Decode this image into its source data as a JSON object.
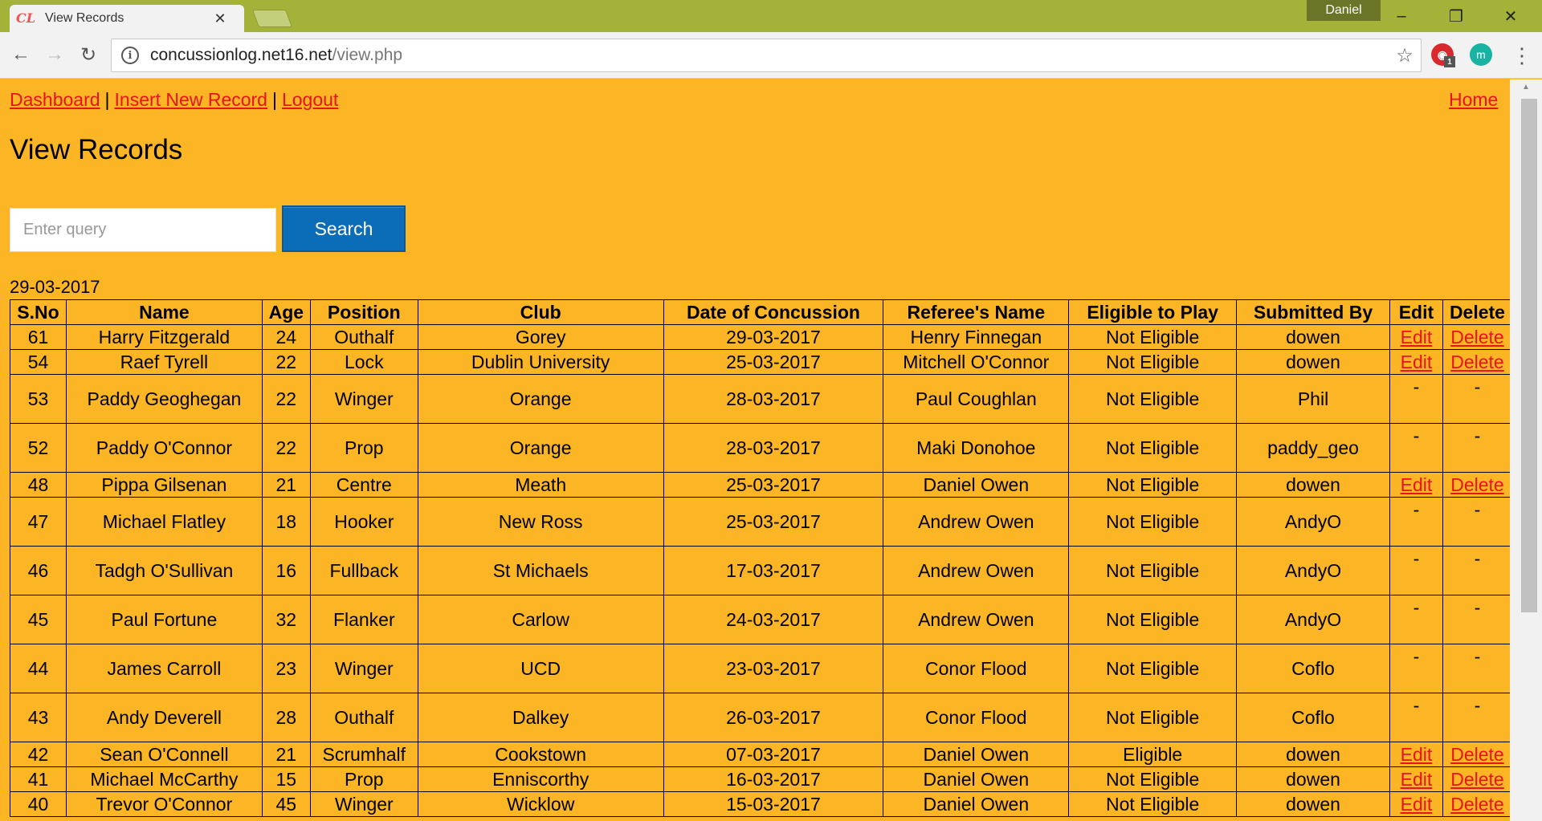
{
  "browser": {
    "tab_title": "View Records",
    "favicon_text": "CL",
    "profile_name": "Daniel",
    "url_host": "concussionlog.net16.net",
    "url_path": "/view.php",
    "ext_badge": "1",
    "ext_teal_letter": "m"
  },
  "nav": {
    "dashboard": "Dashboard",
    "insert": "Insert New Record",
    "logout": "Logout",
    "separator": "|",
    "home": "Home"
  },
  "page": {
    "title": "View Records",
    "search_placeholder": "Enter query",
    "search_button": "Search",
    "date": "29-03-2017"
  },
  "table": {
    "headers": [
      "S.No",
      "Name",
      "Age",
      "Position",
      "Club",
      "Date of Concussion",
      "Referee's Name",
      "Eligible to Play",
      "Submitted By",
      "Edit",
      "Delete"
    ],
    "rows": [
      {
        "sno": "61",
        "name": "Harry Fitzgerald",
        "age": "24",
        "position": "Outhalf",
        "club": "Gorey",
        "date": "29-03-2017",
        "referee": "Henry Finnegan",
        "eligible": "Not Eligible",
        "submitted": "dowen",
        "edit": "Edit",
        "delete": "Delete",
        "tall": false
      },
      {
        "sno": "54",
        "name": "Raef Tyrell",
        "age": "22",
        "position": "Lock",
        "club": "Dublin University",
        "date": "25-03-2017",
        "referee": "Mitchell O'Connor",
        "eligible": "Not Eligible",
        "submitted": "dowen",
        "edit": "Edit",
        "delete": "Delete",
        "tall": false
      },
      {
        "sno": "53",
        "name": "Paddy Geoghegan",
        "age": "22",
        "position": "Winger",
        "club": "Orange",
        "date": "28-03-2017",
        "referee": "Paul Coughlan",
        "eligible": "Not Eligible",
        "submitted": "Phil",
        "edit": "-",
        "delete": "-",
        "tall": true
      },
      {
        "sno": "52",
        "name": "Paddy O'Connor",
        "age": "22",
        "position": "Prop",
        "club": "Orange",
        "date": "28-03-2017",
        "referee": "Maki Donohoe",
        "eligible": "Not Eligible",
        "submitted": "paddy_geo",
        "edit": "-",
        "delete": "-",
        "tall": true
      },
      {
        "sno": "48",
        "name": "Pippa Gilsenan",
        "age": "21",
        "position": "Centre",
        "club": "Meath",
        "date": "25-03-2017",
        "referee": "Daniel Owen",
        "eligible": "Not Eligible",
        "submitted": "dowen",
        "edit": "Edit",
        "delete": "Delete",
        "tall": false
      },
      {
        "sno": "47",
        "name": "Michael Flatley",
        "age": "18",
        "position": "Hooker",
        "club": "New Ross",
        "date": "25-03-2017",
        "referee": "Andrew Owen",
        "eligible": "Not Eligible",
        "submitted": "AndyO",
        "edit": "-",
        "delete": "-",
        "tall": true
      },
      {
        "sno": "46",
        "name": "Tadgh O'Sullivan",
        "age": "16",
        "position": "Fullback",
        "club": "St Michaels",
        "date": "17-03-2017",
        "referee": "Andrew Owen",
        "eligible": "Not Eligible",
        "submitted": "AndyO",
        "edit": "-",
        "delete": "-",
        "tall": true
      },
      {
        "sno": "45",
        "name": "Paul Fortune",
        "age": "32",
        "position": "Flanker",
        "club": "Carlow",
        "date": "24-03-2017",
        "referee": "Andrew Owen",
        "eligible": "Not Eligible",
        "submitted": "AndyO",
        "edit": "-",
        "delete": "-",
        "tall": true
      },
      {
        "sno": "44",
        "name": "James Carroll",
        "age": "23",
        "position": "Winger",
        "club": "UCD",
        "date": "23-03-2017",
        "referee": "Conor Flood",
        "eligible": "Not Eligible",
        "submitted": "Coflo",
        "edit": "-",
        "delete": "-",
        "tall": true
      },
      {
        "sno": "43",
        "name": "Andy Deverell",
        "age": "28",
        "position": "Outhalf",
        "club": "Dalkey",
        "date": "26-03-2017",
        "referee": "Conor Flood",
        "eligible": "Not Eligible",
        "submitted": "Coflo",
        "edit": "-",
        "delete": "-",
        "tall": true
      },
      {
        "sno": "42",
        "name": "Sean O'Connell",
        "age": "21",
        "position": "Scrumhalf",
        "club": "Cookstown",
        "date": "07-03-2017",
        "referee": "Daniel Owen",
        "eligible": "Eligible",
        "submitted": "dowen",
        "edit": "Edit",
        "delete": "Delete",
        "tall": false
      },
      {
        "sno": "41",
        "name": "Michael McCarthy",
        "age": "15",
        "position": "Prop",
        "club": "Enniscorthy",
        "date": "16-03-2017",
        "referee": "Daniel Owen",
        "eligible": "Not Eligible",
        "submitted": "dowen",
        "edit": "Edit",
        "delete": "Delete",
        "tall": false
      },
      {
        "sno": "40",
        "name": "Trevor O'Connor",
        "age": "45",
        "position": "Winger",
        "club": "Wicklow",
        "date": "15-03-2017",
        "referee": "Daniel Owen",
        "eligible": "Not Eligible",
        "submitted": "dowen",
        "edit": "Edit",
        "delete": "Delete",
        "tall": false
      }
    ]
  },
  "colors": {
    "page_bg": "#fbb525",
    "link": "#e8141c",
    "search_button": "#0b6cb8",
    "titlebar": "#a3b33a"
  }
}
